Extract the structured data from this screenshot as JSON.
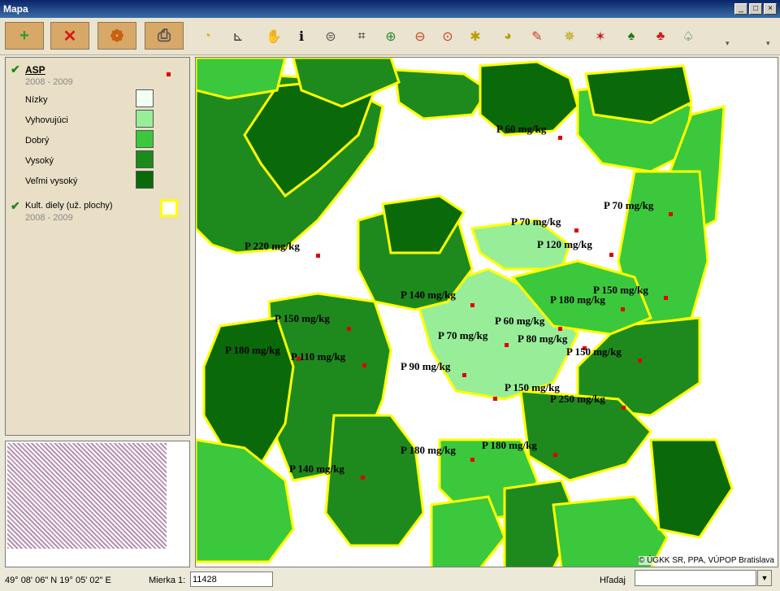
{
  "window": {
    "title": "Mapa",
    "controls": [
      "_",
      "□",
      "×"
    ]
  },
  "toolbar": {
    "big_buttons": [
      {
        "name": "add",
        "glyph": "+",
        "color": "#2f9a2f"
      },
      {
        "name": "delete",
        "glyph": "✕",
        "color": "#d81818"
      },
      {
        "name": "layers",
        "glyph": "❁",
        "color": "#c86010"
      },
      {
        "name": "print",
        "glyph": "⎙",
        "color": "#555555"
      }
    ],
    "tools": [
      {
        "name": "label-abc-icon",
        "glyph": "◔"
      },
      {
        "name": "measure-icon",
        "glyph": "⊾"
      },
      {
        "name": "pan-hand-icon",
        "glyph": "✋"
      },
      {
        "name": "info-icon",
        "glyph": "ℹ"
      },
      {
        "name": "stamp-icon",
        "glyph": "⊜"
      },
      {
        "name": "select-rect-icon",
        "glyph": "⌗"
      },
      {
        "name": "zoom-in-icon",
        "glyph": "⊕"
      },
      {
        "name": "zoom-out-icon",
        "glyph": "⊖"
      },
      {
        "name": "zoom-extent-icon",
        "glyph": "⊙"
      },
      {
        "name": "select-feature-icon",
        "glyph": "✱"
      },
      {
        "name": "label-feature-icon",
        "glyph": "◕"
      },
      {
        "name": "edit-feature-icon",
        "glyph": "✎"
      },
      {
        "name": "select-multi-icon",
        "glyph": "✵"
      },
      {
        "name": "deselect-icon",
        "glyph": "✶"
      },
      {
        "name": "tree-icon",
        "glyph": "♠"
      },
      {
        "name": "tree-remove-icon",
        "glyph": "♣"
      },
      {
        "name": "forest-icon",
        "glyph": "♤"
      }
    ]
  },
  "legend": {
    "layers": [
      {
        "name": "ASP",
        "years": "2008 - 2009",
        "checked": true
      },
      {
        "name": "Kult. diely (už. plochy)",
        "years": "2008 - 2009",
        "checked": true
      }
    ],
    "classes": [
      {
        "label": "Nízky",
        "color": "#f4fff4"
      },
      {
        "label": "Vyhovujúci",
        "color": "#98ee98"
      },
      {
        "label": "Dobrý",
        "color": "#3cc83c"
      },
      {
        "label": "Vysoký",
        "color": "#1e8a1e"
      },
      {
        "label": "Veľmi vysoký",
        "color": "#0a6a0a"
      }
    ],
    "point_color": "#e00000",
    "boundary_color": "#ffff00"
  },
  "map": {
    "credit": "© ÚGKK SR, PPA, VÚPOP Bratislava",
    "labels": [
      {
        "text": "P 60 mg/kg"
      },
      {
        "text": "P 70 mg/kg"
      },
      {
        "text": "P 70 mg/kg"
      },
      {
        "text": "P 220 mg/kg"
      },
      {
        "text": "P 120 mg/kg"
      },
      {
        "text": "P 150 mg/kg"
      },
      {
        "text": "P 140 mg/kg"
      },
      {
        "text": "P 180 mg/kg"
      },
      {
        "text": "P 150 mg/kg"
      },
      {
        "text": "P 60 mg/kg"
      },
      {
        "text": "P 70 mg/kg"
      },
      {
        "text": "P 80 mg/kg"
      },
      {
        "text": "P 180 mg/kg"
      },
      {
        "text": "P 110 mg/kg"
      },
      {
        "text": "P 150 mg/kg"
      },
      {
        "text": "P 90 mg/kg"
      },
      {
        "text": "P 150 mg/kg"
      },
      {
        "text": "P 250 mg/kg"
      },
      {
        "text": "P 180 mg/kg"
      },
      {
        "text": "P 180 mg/kg"
      },
      {
        "text": "P 140 mg/kg"
      }
    ]
  },
  "status": {
    "coords": "49° 08' 06\"  N  19° 05' 02\"  E",
    "scale_label": "Mierka 1:",
    "scale_value": "11428",
    "search_label": "Hľadaj",
    "search_value": ""
  }
}
